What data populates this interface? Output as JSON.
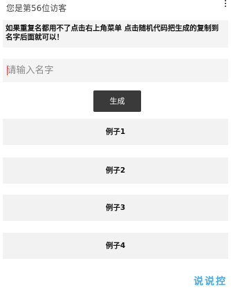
{
  "header": {
    "visitor_text": "您是第56位访客",
    "menu_icon": "more-vert-icon"
  },
  "notice": {
    "text": "如果重复名都用不了点击右上角菜单 点击随机代码把生成的复制到名字后面就可以！"
  },
  "name_input": {
    "value": "",
    "placeholder": "请输入名字"
  },
  "generate_button": {
    "label": "生成"
  },
  "examples": [
    {
      "label": "例子1"
    },
    {
      "label": "例子2"
    },
    {
      "label": "例子3"
    },
    {
      "label": "例子4"
    }
  ],
  "watermark": {
    "text": "说说控"
  },
  "colors": {
    "button_bg": "#3a3a3a",
    "panel_bg": "#f2f2f2",
    "watermark": "#4aa8e0"
  }
}
